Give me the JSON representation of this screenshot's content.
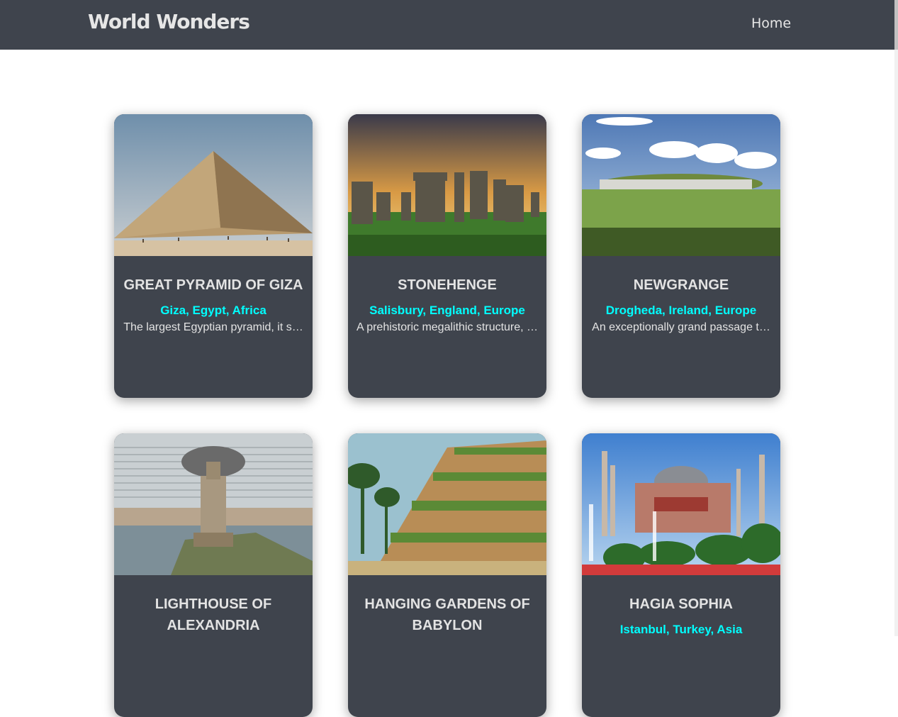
{
  "header": {
    "brand": "World Wonders",
    "nav_home": "Home"
  },
  "cards": [
    {
      "title": "GREAT PYRAMID OF GIZA",
      "location": "Giza, Egypt, Africa",
      "description": "The largest Egyptian pyramid, it s…"
    },
    {
      "title": "STONEHENGE",
      "location": "Salisbury, England, Europe",
      "description": "A prehistoric megalithic structure, …"
    },
    {
      "title": "NEWGRANGE",
      "location": "Drogheda, Ireland, Europe",
      "description": "An exceptionally grand passage t…"
    },
    {
      "title": "LIGHTHOUSE OF ALEXANDRIA",
      "location": "",
      "description": ""
    },
    {
      "title": "HANGING GARDENS OF BABYLON",
      "location": "",
      "description": ""
    },
    {
      "title": "HAGIA SOPHIA",
      "location": "Istanbul, Turkey, Asia",
      "description": ""
    }
  ],
  "colors": {
    "navbar": "#3f444d",
    "card": "#3f444d",
    "location": "#00ffff",
    "text": "#e3e3e3"
  }
}
